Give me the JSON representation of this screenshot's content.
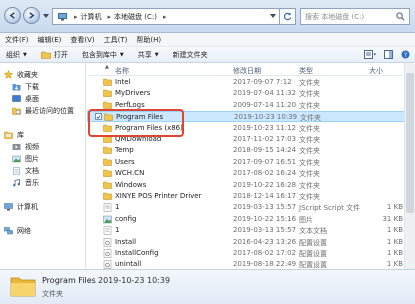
{
  "address": {
    "crumbs": [
      "计算机",
      "本地磁盘 (C:)"
    ],
    "search_placeholder": "搜索 本地磁盘 (C:)"
  },
  "menu": [
    "文件(F)",
    "编辑(E)",
    "查看(V)",
    "工具(T)",
    "帮助(H)"
  ],
  "toolbar": {
    "organize": "组织",
    "open": "打开",
    "include": "包含到库中",
    "share": "共享",
    "new_folder": "新建文件夹"
  },
  "nav": {
    "favorites": "收藏夹",
    "downloads": "下载",
    "desktop": "桌面",
    "recent": "最近访问的位置",
    "libraries": "库",
    "videos": "视频",
    "pictures": "图片",
    "documents": "文档",
    "music": "音乐",
    "computer": "计算机",
    "network": "网络"
  },
  "columns": {
    "name": "名称",
    "date": "修改日期",
    "type": "类型",
    "size": "大小"
  },
  "files": [
    {
      "name": "Intel",
      "date": "2017-09-07 7:12",
      "type": "文件夹",
      "size": "",
      "kind": "folder"
    },
    {
      "name": "MyDrivers",
      "date": "2019-07-04 11:32",
      "type": "文件夹",
      "size": "",
      "kind": "folder"
    },
    {
      "name": "PerfLogs",
      "date": "2009-07-14 11:20",
      "type": "文件夹",
      "size": "",
      "kind": "folder"
    },
    {
      "name": "Program Files",
      "date": "2019-10-23 10:39",
      "type": "文件夹",
      "size": "",
      "kind": "folder"
    },
    {
      "name": "Program Files (x86)",
      "date": "2019-10-23 11:12",
      "type": "文件夹",
      "size": "",
      "kind": "folder"
    },
    {
      "name": "QMDownload",
      "date": "2017-11-02 17:03",
      "type": "文件夹",
      "size": "",
      "kind": "folder"
    },
    {
      "name": "Temp",
      "date": "2018-09-15 14:24",
      "type": "文件夹",
      "size": "",
      "kind": "folder"
    },
    {
      "name": "Users",
      "date": "2017-09-07 16:51",
      "type": "文件夹",
      "size": "",
      "kind": "folder"
    },
    {
      "name": "WCH.CN",
      "date": "2017-08-02 16:24",
      "type": "文件夹",
      "size": "",
      "kind": "folder"
    },
    {
      "name": "Windows",
      "date": "2019-10-22 16:28",
      "type": "文件夹",
      "size": "",
      "kind": "folder"
    },
    {
      "name": "XINYE POS Printer Driver",
      "date": "2018-12-14 16:17",
      "type": "文件夹",
      "size": "",
      "kind": "folder"
    },
    {
      "name": "1",
      "date": "2019-03-13 15:57",
      "type": "JScript Script 文件",
      "size": "1 KB",
      "kind": "script"
    },
    {
      "name": "config",
      "date": "2019-10-22 15:16",
      "type": "图片",
      "size": "31 KB",
      "kind": "image"
    },
    {
      "name": "1",
      "date": "2019-03-13 15:57",
      "type": "文本文档",
      "size": "1 KB",
      "kind": "text"
    },
    {
      "name": "Install",
      "date": "2016-04-23 13:26",
      "type": "配置设置",
      "size": "1 KB",
      "kind": "config"
    },
    {
      "name": "InstallConfig",
      "date": "2017-08-02 17:02",
      "type": "配置设置",
      "size": "1 KB",
      "kind": "config"
    },
    {
      "name": "unintall",
      "date": "2019-08-18 22:49",
      "type": "配置设置",
      "size": "1 KB",
      "kind": "config"
    }
  ],
  "selected_index": 3,
  "details": {
    "name": "Program Files",
    "date": "2019-10-23 10:39",
    "type": "文件夹"
  },
  "colors": {
    "highlight": "#e0452f",
    "selection": "#cce8ff",
    "folder": "#f0c64a"
  }
}
